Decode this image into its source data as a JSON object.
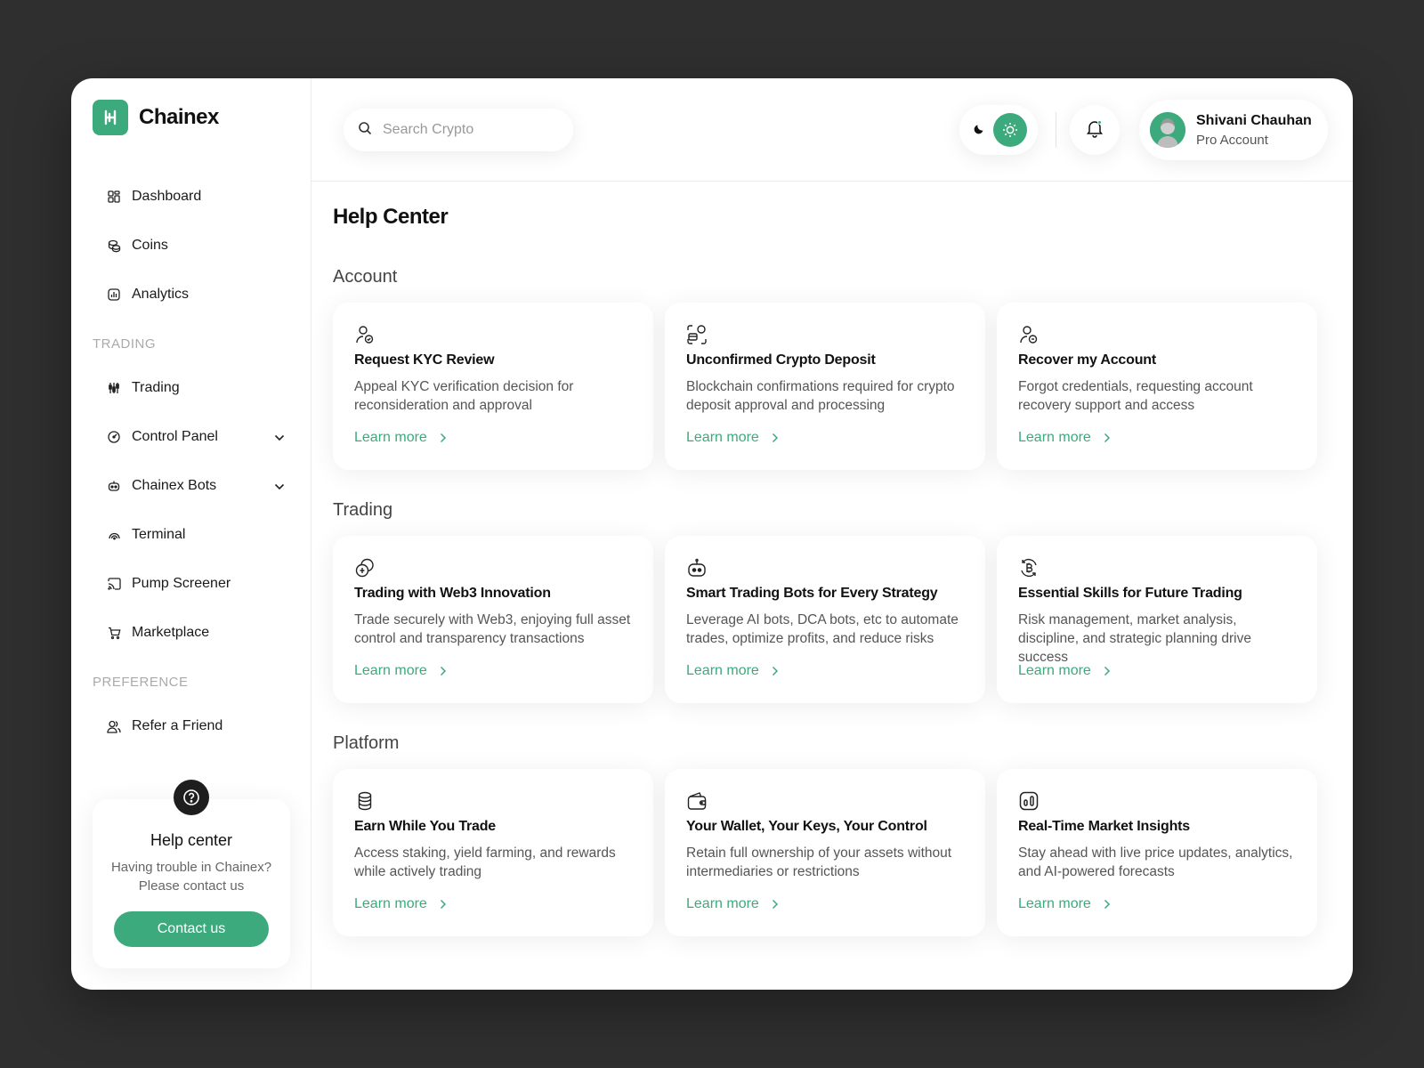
{
  "app": {
    "name": "Chainex",
    "accent": "#3daa7d"
  },
  "sidebar": {
    "items_main": [
      {
        "label": "Dashboard",
        "icon": "dashboard-icon"
      },
      {
        "label": "Coins",
        "icon": "coins-icon"
      },
      {
        "label": "Analytics",
        "icon": "analytics-icon"
      }
    ],
    "section_trading": "TRADING",
    "items_trading": [
      {
        "label": "Trading",
        "icon": "candlestick-icon"
      },
      {
        "label": "Control Panel",
        "icon": "gauge-icon"
      },
      {
        "label": "Chainex Bots",
        "icon": "bot-icon"
      },
      {
        "label": "Terminal",
        "icon": "terminal-icon"
      },
      {
        "label": "Pump Screener",
        "icon": "cast-icon"
      },
      {
        "label": "Marketplace",
        "icon": "cart-icon"
      }
    ],
    "section_preference": "PREFERENCE",
    "items_preference": [
      {
        "label": "Refer a Friend",
        "icon": "users-icon"
      }
    ],
    "help": {
      "title": "Help center",
      "desc": "Having trouble in Chainex? Please contact us",
      "button": "Contact us"
    }
  },
  "header": {
    "search_placeholder": "Search Crypto",
    "user": {
      "name": "Shivani Chauhan",
      "plan": "Pro Account"
    }
  },
  "main": {
    "title": "Help Center",
    "link_label": "Learn more",
    "sections": [
      {
        "title": "Account",
        "cards": [
          {
            "icon": "user-check-icon",
            "title": "Request KYC Review",
            "desc": "Appeal KYC verification decision for reconsideration and approval"
          },
          {
            "icon": "deposit-scan-icon",
            "title": "Unconfirmed Crypto Deposit",
            "desc": "Blockchain confirmations required for crypto deposit approval and processing"
          },
          {
            "icon": "user-recover-icon",
            "title": "Recover my Account",
            "desc": "Forgot credentials, requesting account recovery support and access"
          }
        ]
      },
      {
        "title": "Trading",
        "cards": [
          {
            "icon": "web3-coins-icon",
            "title": "Trading with Web3 Innovation",
            "desc": "Trade securely with Web3, enjoying full asset control and transparency transactions"
          },
          {
            "icon": "bot-icon",
            "title": "Smart Trading Bots for Every Strategy",
            "desc": "Leverage AI bots, DCA bots, etc to automate trades, optimize profits, and reduce risks"
          },
          {
            "icon": "bitcoin-refresh-icon",
            "title": "Essential Skills for Future Trading",
            "desc": "Risk management, market analysis, discipline, and strategic planning drive success"
          }
        ]
      },
      {
        "title": "Platform",
        "cards": [
          {
            "icon": "coin-stack-icon",
            "title": "Earn While You Trade",
            "desc": "Access staking, yield farming, and rewards while actively trading"
          },
          {
            "icon": "wallet-icon",
            "title": "Your Wallet, Your Keys, Your Control",
            "desc": "Retain full ownership of your assets without intermediaries or restrictions"
          },
          {
            "icon": "chart-box-icon",
            "title": "Real-Time Market Insights",
            "desc": "Stay ahead with live price updates, analytics, and AI-powered forecasts"
          }
        ]
      }
    ]
  }
}
